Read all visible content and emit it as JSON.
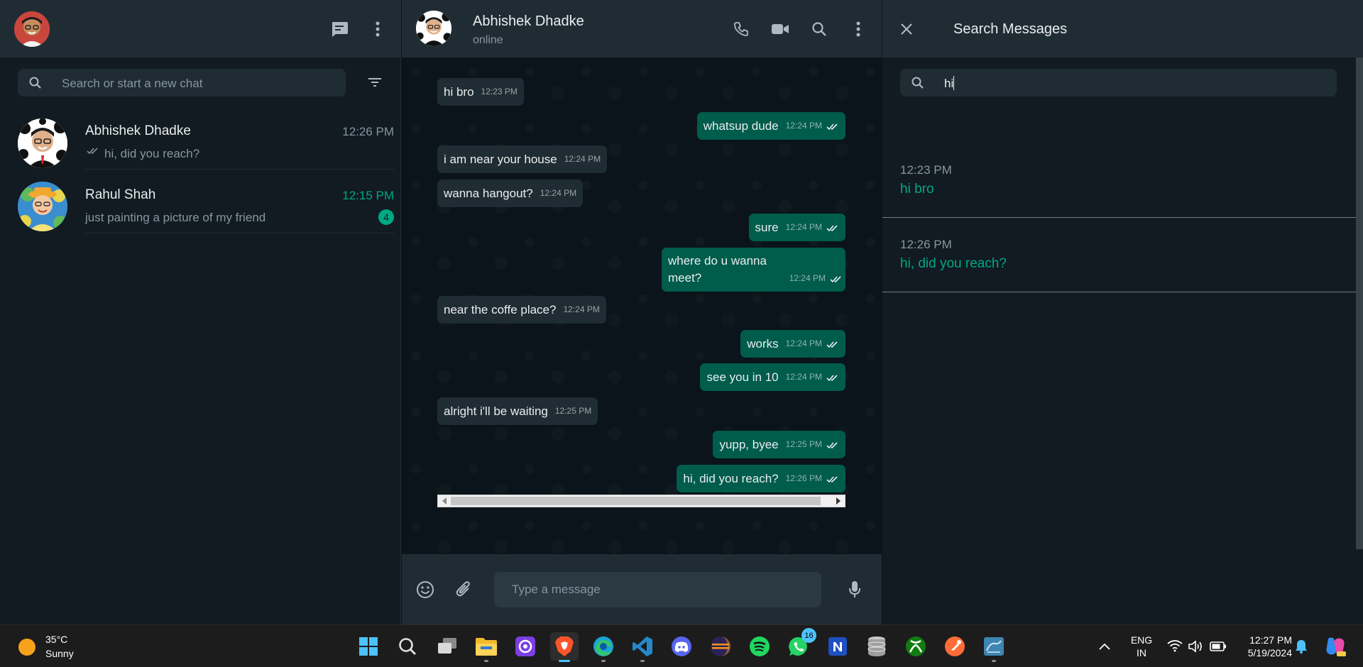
{
  "sidebar": {
    "search_placeholder": "Search or start a new chat",
    "chats": [
      {
        "name": "Abhishek Dhadke",
        "time": "12:26 PM",
        "preview": "hi, did you reach?",
        "delivered": true,
        "unread": null
      },
      {
        "name": "Rahul Shah",
        "time": "12:15 PM",
        "preview": "just painting a picture of my friend",
        "delivered": false,
        "unread": "4"
      }
    ]
  },
  "conversation": {
    "contact_name": "Abhishek Dhadke",
    "status": "online",
    "messages": [
      {
        "dir": "in",
        "text": "hi bro",
        "time": "12:23 PM"
      },
      {
        "dir": "out",
        "text": "whatsup dude",
        "time": "12:24 PM"
      },
      {
        "dir": "in",
        "text": "i am near your house",
        "time": "12:24 PM"
      },
      {
        "dir": "in",
        "text": "wanna hangout?",
        "time": "12:24 PM"
      },
      {
        "dir": "out",
        "text": "sure",
        "time": "12:24 PM"
      },
      {
        "dir": "out",
        "text": "where do u wanna meet?",
        "time": "12:24 PM"
      },
      {
        "dir": "in",
        "text": "near the coffe place?",
        "time": "12:24 PM"
      },
      {
        "dir": "out",
        "text": "works",
        "time": "12:24 PM"
      },
      {
        "dir": "out",
        "text": "see you in 10",
        "time": "12:24 PM"
      },
      {
        "dir": "in",
        "text": "alright i'll be waiting",
        "time": "12:25 PM"
      },
      {
        "dir": "out",
        "text": "yupp, byee",
        "time": "12:25 PM"
      },
      {
        "dir": "out",
        "text": "hi, did you reach?",
        "time": "12:26 PM"
      }
    ],
    "input_placeholder": "Type a message"
  },
  "search_panel": {
    "title": "Search Messages",
    "query": "hi",
    "results": [
      {
        "time": "12:23 PM",
        "text": "hi bro"
      },
      {
        "time": "12:26 PM",
        "text": "hi, did you reach?"
      }
    ]
  },
  "taskbar": {
    "weather_temp": "35°C",
    "weather_desc": "Sunny",
    "whatsapp_badge": "16",
    "lang_top": "ENG",
    "lang_bottom": "IN",
    "clock_time": "12:27 PM",
    "clock_date": "5/19/2024",
    "apps": [
      "start-icon",
      "search-icon",
      "task-view-icon",
      "file-explorer-icon",
      "app-icon",
      "brave-icon",
      "edge-icon",
      "vscode-icon",
      "discord-icon",
      "eclipse-icon",
      "spotify-icon",
      "whatsapp-icon",
      "notion-icon",
      "database-icon",
      "xbox-icon",
      "postman-icon",
      "mysql-workbench-icon"
    ]
  },
  "colors": {
    "accent": "#00a884",
    "outgoing_bubble": "#005c4b",
    "incoming_bubble": "#202c33",
    "panel_bg": "#111b21",
    "header_bg": "#202c33",
    "read_tick": "#53bdeb"
  }
}
